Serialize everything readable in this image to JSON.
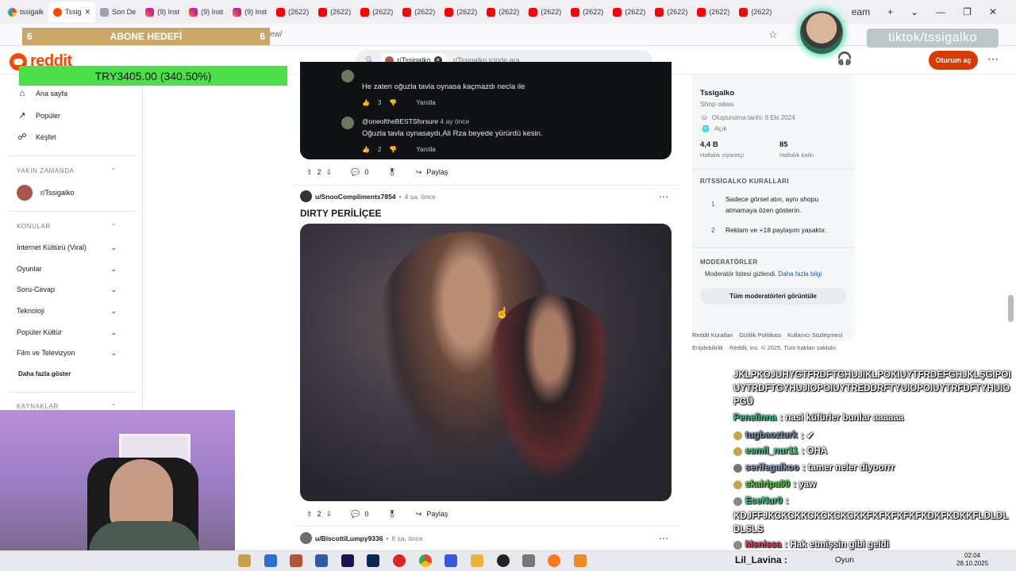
{
  "browser": {
    "tabs": [
      {
        "label": "tssigalk",
        "icon": "google-icon",
        "fav": "g"
      },
      {
        "label": "Tssig",
        "icon": "reddit-icon",
        "fav": "rd",
        "active": true
      },
      {
        "label": "Son De",
        "icon": "sd-icon",
        "fav": "sd"
      },
      {
        "label": "(9) Inst",
        "icon": "instagram-icon",
        "fav": "ig"
      },
      {
        "label": "(9) Inst",
        "icon": "instagram-icon",
        "fav": "ig"
      },
      {
        "label": "(9) Inst",
        "icon": "instagram-icon",
        "fav": "ig"
      },
      {
        "label": "(2622)",
        "icon": "youtube-icon",
        "fav": "yt"
      },
      {
        "label": "(2622)",
        "icon": "youtube-icon",
        "fav": "yt"
      },
      {
        "label": "(2622)",
        "icon": "youtube-icon",
        "fav": "yt"
      },
      {
        "label": "(2622)",
        "icon": "youtube-icon",
        "fav": "yt"
      },
      {
        "label": "(2622)",
        "icon": "youtube-icon",
        "fav": "yt"
      },
      {
        "label": "(2622)",
        "icon": "youtube-icon",
        "fav": "yt"
      },
      {
        "label": "(2622)",
        "icon": "youtube-icon",
        "fav": "yt"
      },
      {
        "label": "(2622)",
        "icon": "youtube-icon",
        "fav": "yt"
      },
      {
        "label": "(2622)",
        "icon": "youtube-icon",
        "fav": "yt"
      },
      {
        "label": "(2622)",
        "icon": "youtube-icon",
        "fav": "yt"
      },
      {
        "label": "(2622)",
        "icon": "youtube-icon",
        "fav": "yt"
      },
      {
        "label": "(2622)",
        "icon": "youtube-icon",
        "fav": "yt"
      }
    ],
    "extra_tab": "eam",
    "new_tab": "+",
    "tab_menu": "⌄",
    "win_min": "—",
    "win_max": "❐",
    "win_close": "✕",
    "url_partial": "ew/"
  },
  "overlay": {
    "goal_left": "6",
    "goal_title": "ABONE HEDEFİ",
    "goal_right": "6",
    "donation": "TRY3405.00 (340.50%)",
    "tiktok": "tiktok/tssigalko"
  },
  "header": {
    "logo": "reddit",
    "search_chip": "r/Tssigalko",
    "search_placeholder": "r/Tssigalko içinde ara",
    "login": "Oturum aç"
  },
  "sidebar": {
    "nav": [
      {
        "label": "Ana sayfa",
        "icon": "home-icon",
        "glyph": "⌂"
      },
      {
        "label": "Popüler",
        "icon": "popular-icon",
        "glyph": "↗"
      },
      {
        "label": "Keşfet",
        "icon": "explore-icon",
        "glyph": "☍"
      }
    ],
    "recent_header": "YAKIN ZAMANDA",
    "recent_item": "r/Tssigalko",
    "topics_header": "KONULAR",
    "topics": [
      "İnternet Kültürü (Viral)",
      "Oyunlar",
      "Soru-Cevap",
      "Teknoloji",
      "Popüler Kültür",
      "Film ve Televizyon"
    ],
    "more": "Daha fazla göster",
    "resources_header": "KAYNAKLAR"
  },
  "feed": {
    "comment1_text": "He zaten oğuzla tavla oynasa kaçmazdı necla ile",
    "comment1_votes": "3",
    "reply_label": "Yanıtla",
    "comment2_user": "@oneoftheBESTSforsure",
    "comment2_time": "4 ay önce",
    "comment2_text": "Oğuzla tavla oynasaydı,Ali Rza beyede yürürdü kesin.",
    "comment2_votes": "2",
    "post1_votes": "2",
    "post1_comments": "0",
    "share_label": "Paylaş",
    "post2_user": "u/SnooCompliments7854",
    "post2_time": "4 sa. önce",
    "post2_title": "DIRTY PERİLİÇEE",
    "post2_votes": "2",
    "post2_comments": "0",
    "post3_user": "u/BiscottiLumpy9336",
    "post3_time": "6 sa. önce"
  },
  "community": {
    "name": "Tssigalko",
    "desc": "Shop odası",
    "created": "Oluşturulma tarihi: 8 Eki 2024",
    "status": "Açık",
    "visitors_value": "4,4 B",
    "visitors_label": "Haftalık ziyaretçi",
    "contrib_value": "85",
    "contrib_label": "Haftalık katkı",
    "rules_header": "R/TSSİGALKO KURALLARI",
    "rule1_num": "1",
    "rule1": "Sadece görsel atın, aynı shopu atmamaya özen gösterin.",
    "rule2_num": "2",
    "rule2": "Reklam ve +18 paylaşım yasaktır.",
    "mods_header": "MODERATÖRLER",
    "mods_hidden": "Moderatör listesi gizlendi.",
    "mods_more": "Daha fazla bilgi",
    "mods_button": "Tüm moderatörleri görüntüle"
  },
  "footer": {
    "links": [
      "Reddit Kuralları",
      "Gizlilik Politikası",
      "Kullanıcı Sözleşmesi"
    ],
    "accessibility": "Erişilebilirlik",
    "copyright": "Reddit, Inc. © 2025. Tüm hakları saklıdır."
  },
  "chat": {
    "spam1": "JKLPKOJUHYGTFRDFTGHUJIKLPOKIUYTFRDEFGHJKLŞGIPOIUYTRDFTGYHUJIOPOIUYTREDDRFTYUIOPOIUYTRFDFTYHUIOPGÜ",
    "messages": [
      {
        "user": "Penelinna",
        "text": ": nasi küfürler bunlar aaaaaa",
        "color": "#3fcf8e"
      },
      {
        "user": "tugbaozturk",
        "text": ": ✔",
        "color": "#7a8fb0"
      },
      {
        "user": "esmil_nur11",
        "text": ": OHA",
        "color": "#3fcf8e"
      },
      {
        "user": "serifegalkoo",
        "text": ": tamer neler diyoorrr",
        "color": "#8fa3c7"
      },
      {
        "user": "skairipa90",
        "text": ": yaw",
        "color": "#57d946"
      },
      {
        "user": "EceNur0",
        "text": ":",
        "color": "#3fcf8e"
      }
    ],
    "spam2": "KDJFFJKCKCKKCKCKCKCKKFKFKFKFKFKDKFKDKKFLDLDLDLSLS",
    "last_user": "Msnissa",
    "last_text": ": Hak etmişsin gibi geldi"
  },
  "taskbar": {
    "user": "Lil_Lavina :",
    "game": "Oyun",
    "time": "02:04",
    "date": "28.10.2025"
  }
}
